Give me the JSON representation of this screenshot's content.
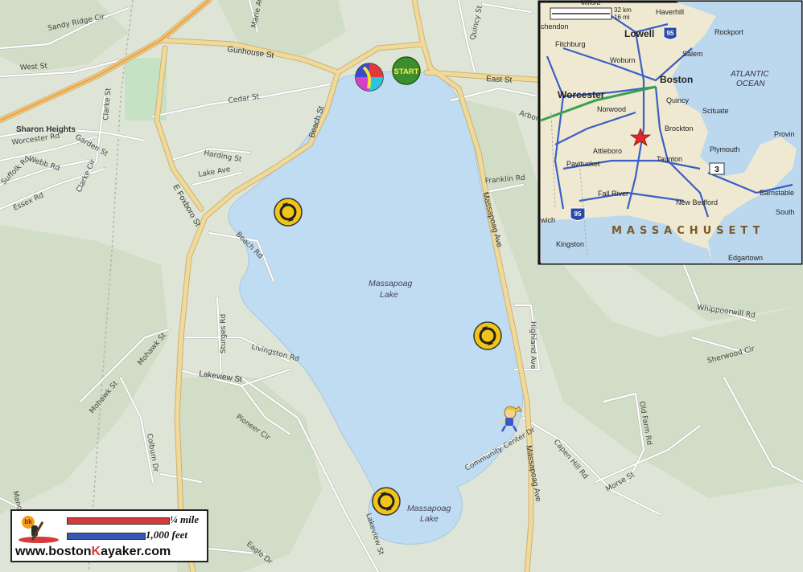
{
  "roads": {
    "sandy_ridge": "Sandy Ridge Cir",
    "marie": "Marie Ave",
    "quincy": "Quincy St",
    "gunhouse": "Gunhouse St",
    "west": "West St",
    "east": "East St",
    "cedar": "Cedar St",
    "beach_st": "Beach St",
    "arbor": "Arbor",
    "harding": "Harding St",
    "lake_ave": "Lake Ave",
    "worcester": "Worcester Rd",
    "webb": "Webb Rd",
    "suffolk": "Suffolk Rd",
    "essex": "Essex Rd",
    "clarke_st": "Clarke St",
    "clarke_cir": "Clarke Cir",
    "garden": "Garden St",
    "e_foxboro": "E Foxboro St",
    "beach_rd": "Beach Rd",
    "franklin": "Franklin Rd",
    "massapoag_ave": "Massapoag Ave",
    "massapoag_ave2": "Massapoag Ave",
    "highland": "Highland Ave",
    "sturges": "Sturges Rd",
    "livingston": "Livingston Rd",
    "mohawk": "Mohawk St",
    "mohawk2": "Mohawk St",
    "lakeview_st": "Lakeview St",
    "pioneer": "Pioneer Cir",
    "colburn": "Colburn Dr",
    "community": "Community Center Dr",
    "capen": "Capen Hill Rd",
    "morse": "Morse St",
    "old_farm": "Old Farm Rd",
    "whippoorwill": "Whippoorwill Rd",
    "sherwood": "Sherwood Cir",
    "lakeview_st2": "Lakeview St",
    "eagle": "Eagle Dr",
    "manor": "Manor"
  },
  "places": {
    "sharon_heights": "Sharon Heights",
    "lake_main_1": "Massapoag",
    "lake_main_2": "Lake",
    "lake_south_1": "Massapoag",
    "lake_south_2": "Lake"
  },
  "markers": {
    "start": "START"
  },
  "inset": {
    "scale_km": "32 km",
    "scale_mi": "16 mi",
    "chendon": "chendon",
    "milford": "Milford",
    "haverhill": "Haverhill",
    "lowell": "Lowell",
    "fitchburg": "Fitchburg",
    "woburn": "Woburn",
    "salem": "Salem",
    "rockport": "Rockport",
    "boston": "Boston",
    "ocean1": "ATLANTIC",
    "ocean2": "OCEAN",
    "worcester": "Worcester",
    "norwood": "Norwood",
    "quincy": "Quincy",
    "scituate": "Scituate",
    "brockton": "Brockton",
    "provin": "Provin",
    "attleboro": "Attleboro",
    "plymouth": "Plymouth",
    "pawtucket": "Pawtucket",
    "taunton": "Taunton",
    "fall_river": "Fall River",
    "new_bedford": "New Bedford",
    "barnstable": "Barnstable",
    "south": "South",
    "wich": "wich",
    "kingston": "Kingston",
    "state": "MASSACHUSETT",
    "edgartown": "Edgartown",
    "shield_95a": "95",
    "shield_95b": "95",
    "shield_3": "3"
  },
  "legend": {
    "quarter_mile": "¼ mile",
    "thousand_feet": "1,000 feet",
    "logo_badge": "bk",
    "url_prefix": "www.boston",
    "url_k": "K",
    "url_suffix": "ayaker.com"
  },
  "colors": {
    "water": "#bfdcf2",
    "land": "#dfe5d6",
    "forest": "#cfdcc4",
    "start_marker": "#3a8f2c",
    "rotation_marker": "#f2c418",
    "legend_red": "#d43c3c",
    "legend_blue": "#3a56b4"
  }
}
